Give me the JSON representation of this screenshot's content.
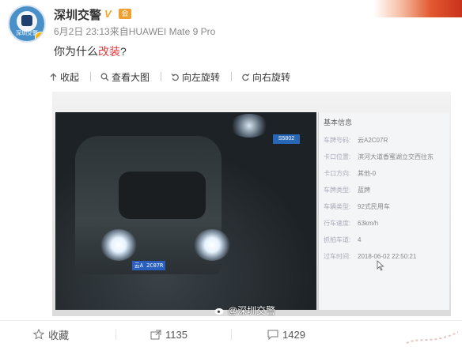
{
  "header": {
    "username": "深圳交警",
    "verified_mark": "V",
    "level_icon": "会",
    "meta": "6月2日 23:13来自HUAWEI Mate 9 Pro",
    "post_prefix": "你为什么",
    "post_highlight": "改装",
    "post_suffix": "?",
    "avatar_label": "深圳交警"
  },
  "toolbar": {
    "items": [
      {
        "label": "收起",
        "icon": "arrow-up-icon"
      },
      {
        "label": "查看大图",
        "icon": "search-icon"
      },
      {
        "label": "向左旋转",
        "icon": "rotate-left-icon"
      },
      {
        "label": "向右旋转",
        "icon": "rotate-right-icon"
      }
    ]
  },
  "photo": {
    "plate_text": "云A 2C07R",
    "sign_text": "S5802",
    "watermark": "@深圳交警",
    "panel": {
      "title": "基本信息",
      "rows": [
        {
          "label": "车牌号码:",
          "value": "云A2C07R"
        },
        {
          "label": "卡口位置:",
          "value": "滨河大道香蜜湖立交西往东"
        },
        {
          "label": "卡口方向:",
          "value": "其他-0"
        },
        {
          "label": "车牌类型:",
          "value": "蓝牌"
        },
        {
          "label": "车辆类型:",
          "value": "92式民用车"
        },
        {
          "label": "行车速度:",
          "value": "63km/h"
        },
        {
          "label": "抓拍车道:",
          "value": "4"
        },
        {
          "label": "过车时间:",
          "value": "2018-06-02 22:50:21"
        }
      ]
    }
  },
  "footer": {
    "favorite": "收藏",
    "repost_count": "1135",
    "comment_count": "1429"
  },
  "colors": {
    "highlight": "#e4393c",
    "verified": "#f5a623",
    "plate": "#2a5fc0"
  }
}
